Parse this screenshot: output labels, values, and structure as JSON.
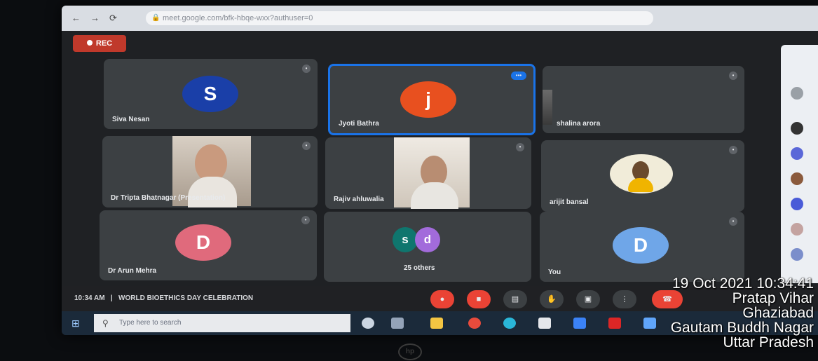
{
  "browser": {
    "url": "meet.google.com/bfk-hbqe-wxx?authuser=0"
  },
  "rec": {
    "label": "REC"
  },
  "tiles": [
    {
      "name": "Siva Nesan",
      "initial": "S",
      "color": "#1a3fa8"
    },
    {
      "name": "Jyoti Bathra",
      "initial": "j",
      "color": "#e8501f"
    },
    {
      "name": "shalina arora",
      "initial": "",
      "color": ""
    },
    {
      "name": "Dr Tripta Bhatnagar (Presentation)"
    },
    {
      "name": "Rajiv ahluwalia"
    },
    {
      "name": "arijit bansal"
    },
    {
      "name": "Dr Arun Mehra",
      "initial": "D",
      "color": "#e06a7c"
    },
    {
      "name": "25 others",
      "initials": [
        "s",
        "d"
      ],
      "colors": [
        "#0f766e",
        "#a26bdb"
      ]
    },
    {
      "name": "You",
      "initial": "D",
      "color": "#6fa6e8"
    }
  ],
  "meeting": {
    "time": "10:34 AM",
    "separator": "|",
    "title": "WORLD BIOETHICS DAY CELEBRATION"
  },
  "taskbar": {
    "search_placeholder": "Type here to search"
  },
  "stamp": {
    "datetime": "19 Oct 2021 10:34:41",
    "line1": "Pratap Vihar",
    "line2": "Ghaziabad",
    "line3": "Gautam Buddh Nagar",
    "line4": "Uttar Pradesh"
  },
  "brand": {
    "logo": "hp"
  }
}
